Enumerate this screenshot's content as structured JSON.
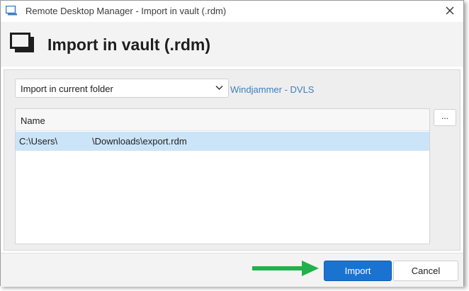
{
  "window": {
    "title": "Remote Desktop Manager - Import in vault (.rdm)",
    "close_icon": "close-icon",
    "app_icon": "monitor-icon"
  },
  "header": {
    "title": "Import in vault (.rdm)",
    "icon": "monitor-icon"
  },
  "import_options": {
    "destination_select": {
      "selected": "Import in current folder",
      "icon": "chevron-down-icon"
    },
    "vault_link": "Windjammer - DVLS"
  },
  "file_list": {
    "columns": [
      "Name"
    ],
    "rows": [
      {
        "path_start": "C:\\Users\\",
        "path_end": "\\Downloads\\export.rdm"
      }
    ],
    "browse_label": "..."
  },
  "footer": {
    "import_label": "Import",
    "cancel_label": "Cancel",
    "annotation_arrow_color": "#22b14c",
    "import_color": "#1a73d1"
  }
}
